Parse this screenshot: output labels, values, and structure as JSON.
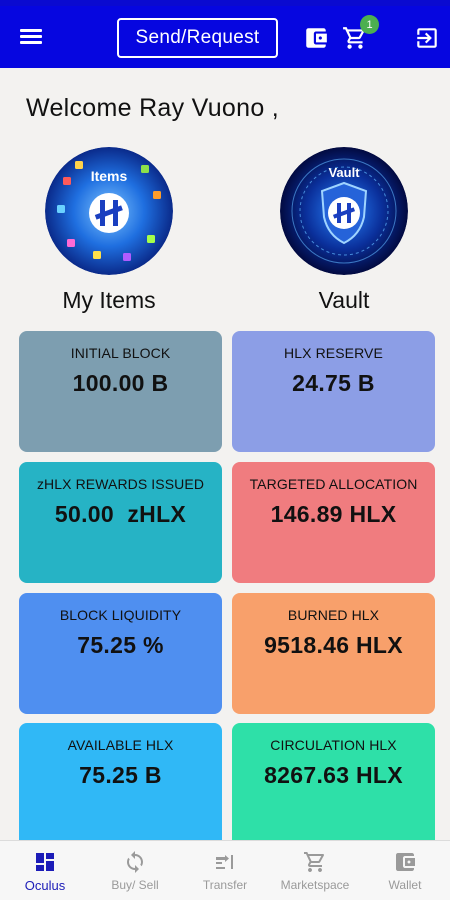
{
  "header": {
    "send_request_label": "Send/Request",
    "cart_count": "1",
    "icons": [
      "menu-icon",
      "wallet-icon",
      "cart-icon",
      "logout-icon"
    ]
  },
  "welcome_text": "Welcome Ray Vuono ,",
  "tiles": {
    "items": {
      "label": "My Items",
      "image_text": "Items"
    },
    "vault": {
      "label": "Vault",
      "image_text": "Vault"
    }
  },
  "stats": [
    {
      "label": "INITIAL BLOCK",
      "value": "100.00 B",
      "color": "#7d9eb0"
    },
    {
      "label": "HLX RESERVE",
      "value": "24.75 B",
      "color": "#8c9ee6"
    },
    {
      "label": "zHLX REWARDS ISSUED",
      "value": "50.00  zHLX",
      "color": "#26b3c5"
    },
    {
      "label": "TARGETED ALLOCATION",
      "value": "146.89 HLX",
      "color": "#f07c7f"
    },
    {
      "label": "BLOCK LIQUIDITY",
      "value": "75.25 %",
      "color": "#4f8ff0"
    },
    {
      "label": "BURNED HLX",
      "value": "9518.46 HLX",
      "color": "#f8a06b"
    },
    {
      "label": "AVAILABLE HLX",
      "value": "75.25 B",
      "color": "#30b8f6"
    },
    {
      "label": "CIRCULATION HLX",
      "value": "8267.63 HLX",
      "color": "#2ee0a8"
    }
  ],
  "bottom_nav": [
    {
      "label": "Oculus",
      "icon": "dashboard-icon",
      "active": true
    },
    {
      "label": "Buy/ Sell",
      "icon": "sync-icon",
      "active": false
    },
    {
      "label": "Transfer",
      "icon": "transfer-icon",
      "active": false
    },
    {
      "label": "Marketspace",
      "icon": "cart-icon",
      "active": false
    },
    {
      "label": "Wallet",
      "icon": "wallet-icon",
      "active": false
    }
  ],
  "colors": {
    "app_bar": "#0606e0",
    "active_nav": "#1c1cb8",
    "inactive_nav": "#9a9a9a",
    "background": "#f3f2f0"
  }
}
